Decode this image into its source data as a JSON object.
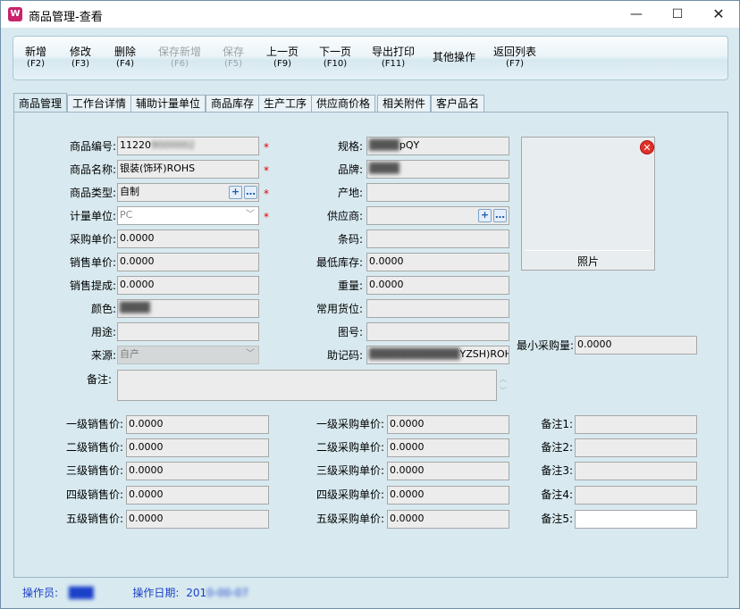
{
  "window": {
    "title": "商品管理-查看",
    "icon": "app-icon"
  },
  "toolbar": {
    "buttons": [
      {
        "label": "新增",
        "key": "(F2)",
        "enabled": true
      },
      {
        "label": "修改",
        "key": "(F3)",
        "enabled": true
      },
      {
        "label": "删除",
        "key": "(F4)",
        "enabled": true
      },
      {
        "label": "保存新增",
        "key": "(F6)",
        "enabled": false
      },
      {
        "label": "保存",
        "key": "(F5)",
        "enabled": false
      },
      {
        "label": "上一页",
        "key": "(F9)",
        "enabled": true
      },
      {
        "label": "下一页",
        "key": "(F10)",
        "enabled": true
      },
      {
        "label": "导出打印",
        "key": "(F11)",
        "enabled": true
      },
      {
        "label": "其他操作",
        "key": "",
        "enabled": true
      },
      {
        "label": "返回列表",
        "key": "(F7)",
        "enabled": true
      }
    ]
  },
  "tabs": [
    "商品管理",
    "工作台详情",
    "辅助计量单位",
    "商品库存",
    "生产工序",
    "供应商价格",
    "相关附件",
    "客户品名"
  ],
  "form": {
    "left": [
      {
        "label": "商品编号:",
        "value": "11220",
        "required": true
      },
      {
        "label": "商品名称:",
        "value": "                  银装(饰环)ROHS",
        "required": true
      },
      {
        "label": "商品类型:",
        "value": "自制",
        "required": true
      },
      {
        "label": "计量单位:",
        "value": "PC",
        "required": true
      },
      {
        "label": "采购单价:",
        "value": "0.0000"
      },
      {
        "label": "销售单价:",
        "value": "0.0000"
      },
      {
        "label": "销售提成:",
        "value": "0.0000"
      },
      {
        "label": "颜色:",
        "value": ""
      },
      {
        "label": "用途:",
        "value": ""
      },
      {
        "label": "来源:",
        "value": "自产"
      }
    ],
    "middle": [
      {
        "label": "规格:",
        "value": "pQY"
      },
      {
        "label": "品牌:",
        "value": ""
      },
      {
        "label": "产地:",
        "value": ""
      },
      {
        "label": "供应商:",
        "value": ""
      },
      {
        "label": "条码:",
        "value": ""
      },
      {
        "label": "最低库存:",
        "value": "0.0000"
      },
      {
        "label": "重量:",
        "value": "0.0000"
      },
      {
        "label": "常用货位:",
        "value": ""
      },
      {
        "label": "图号:",
        "value": ""
      },
      {
        "label": "助记码:",
        "value": "YZSH)ROHS"
      }
    ],
    "min_purchase": {
      "label": "最小采购量:",
      "value": "0.0000"
    },
    "photo_label": "照片",
    "remark": {
      "label": "备注:",
      "value": ""
    },
    "sale_prices": [
      {
        "label": "一级销售价:",
        "value": "0.0000"
      },
      {
        "label": "二级销售价:",
        "value": "0.0000"
      },
      {
        "label": "三级销售价:",
        "value": "0.0000"
      },
      {
        "label": "四级销售价:",
        "value": "0.0000"
      },
      {
        "label": "五级销售价:",
        "value": "0.0000"
      }
    ],
    "purchase_prices": [
      {
        "label": "一级采购单价:",
        "value": "0.0000"
      },
      {
        "label": "二级采购单价:",
        "value": "0.0000"
      },
      {
        "label": "三级采购单价:",
        "value": "0.0000"
      },
      {
        "label": "四级采购单价:",
        "value": "0.0000"
      },
      {
        "label": "五级采购单价:",
        "value": "0.0000"
      }
    ],
    "remarks": [
      {
        "label": "备注1:",
        "value": ""
      },
      {
        "label": "备注2:",
        "value": ""
      },
      {
        "label": "备注3:",
        "value": ""
      },
      {
        "label": "备注4:",
        "value": ""
      },
      {
        "label": "备注5:",
        "value": ""
      }
    ]
  },
  "status": {
    "operator_label": "操作员:",
    "date_label": "操作日期:",
    "date_value": "201"
  }
}
